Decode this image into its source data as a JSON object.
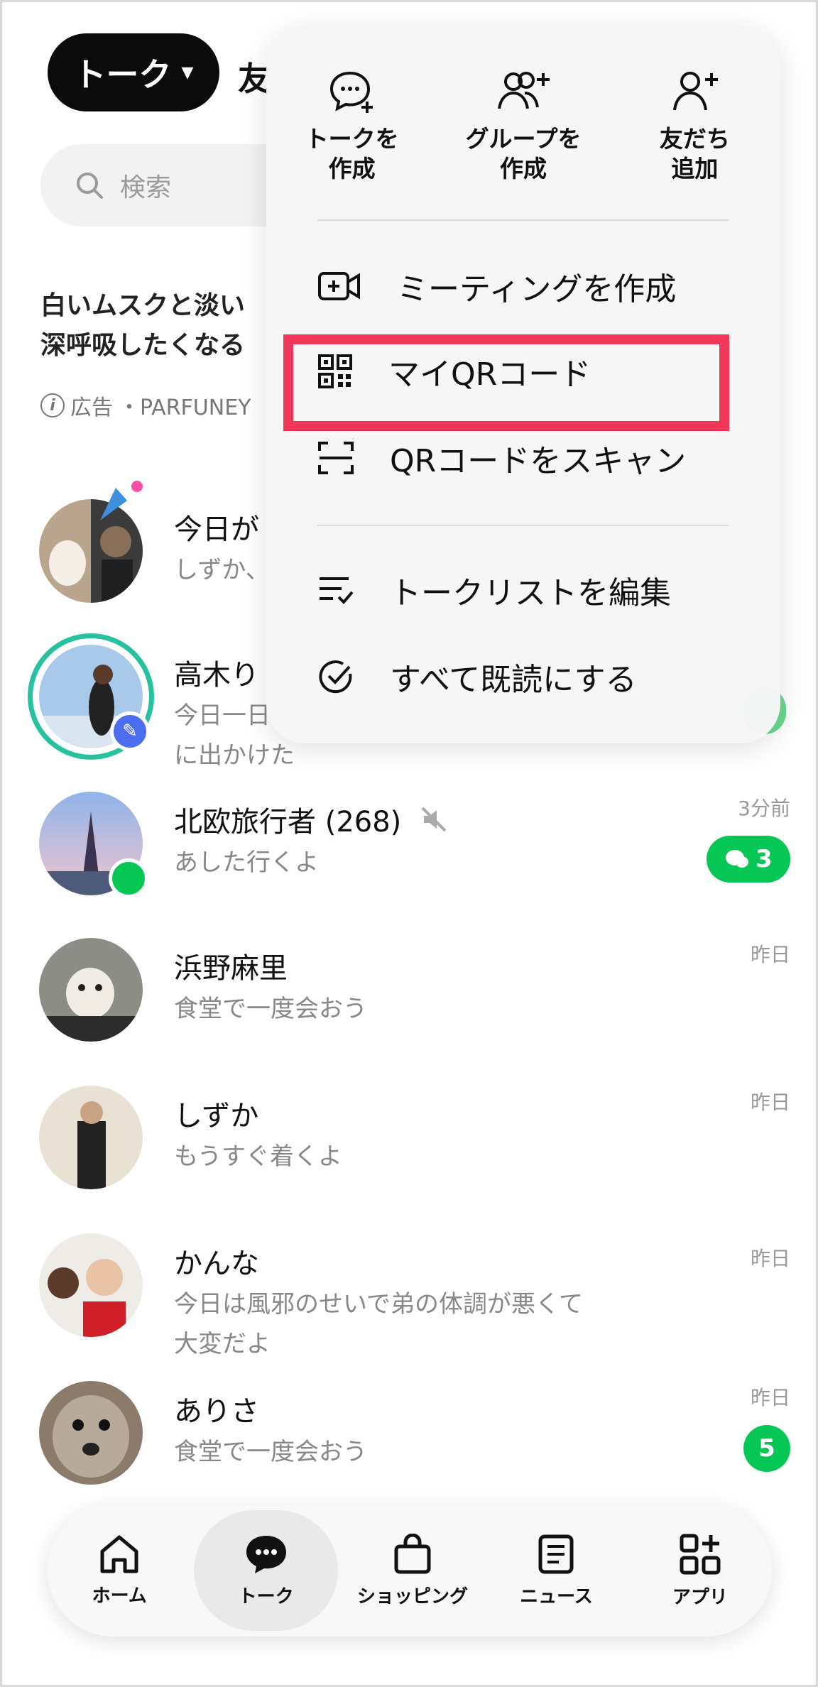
{
  "header": {
    "active_tab": "トーク",
    "next_tab": "友"
  },
  "search": {
    "placeholder": "検索"
  },
  "ad": {
    "line1": "白いムスクと淡い",
    "line2": "深呼吸したくなる",
    "label": "広告",
    "sponsor": "・PARFUNEY"
  },
  "chats": [
    {
      "name": "今日が",
      "preview": "しずか、",
      "time": "",
      "badge": ""
    },
    {
      "name": "高木り",
      "preview": "今日一日\nに出かけた",
      "time": "",
      "badge": ""
    },
    {
      "name": "北欧旅行者 (268)",
      "preview": "あした行くよ",
      "time": "3分前",
      "badge": "3",
      "muted": true
    },
    {
      "name": "浜野麻里",
      "preview": "食堂で一度会おう",
      "time": "昨日",
      "badge": ""
    },
    {
      "name": "しずか",
      "preview": "もうすぐ着くよ",
      "time": "昨日",
      "badge": ""
    },
    {
      "name": "かんな",
      "preview": "今日は風邪のせいで弟の体調が悪くて\n大変だよ",
      "time": "昨日",
      "badge": ""
    },
    {
      "name": "ありさ",
      "preview": "食堂で一度会おう",
      "time": "昨日",
      "badge": "5"
    }
  ],
  "menu": {
    "quick_actions": [
      {
        "icon": "chat-plus-icon",
        "label": "トークを\n作成"
      },
      {
        "icon": "group-plus-icon",
        "label": "グループを\n作成"
      },
      {
        "icon": "person-plus-icon",
        "label": "友だち\n追加"
      }
    ],
    "items": [
      {
        "icon": "video-plus-icon",
        "label": "ミーティングを作成"
      },
      {
        "icon": "qr-code-icon",
        "label": "マイQRコード"
      },
      {
        "icon": "scan-icon",
        "label": "QRコードをスキャン"
      },
      {
        "icon": "edit-list-icon",
        "label": "トークリストを編集"
      },
      {
        "icon": "check-circle-icon",
        "label": "すべて既読にする"
      }
    ],
    "highlight_color": "#f0375a"
  },
  "nav": [
    {
      "icon": "home-icon",
      "label": "ホーム"
    },
    {
      "icon": "talk-icon",
      "label": "トーク"
    },
    {
      "icon": "shopping-bag-icon",
      "label": "ショッピング"
    },
    {
      "icon": "news-icon",
      "label": "ニュース"
    },
    {
      "icon": "apps-icon",
      "label": "アプリ"
    }
  ],
  "colors": {
    "accent_green": "#06c755",
    "highlight": "#f0375a"
  }
}
